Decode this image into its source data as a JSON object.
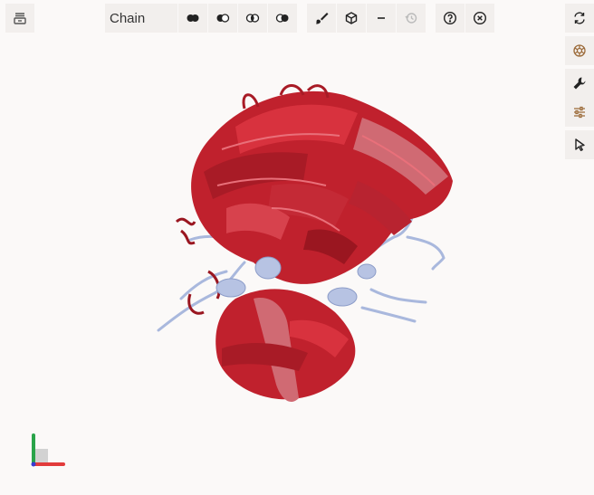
{
  "toolbar": {
    "coloring_select": {
      "value": "Chain"
    }
  },
  "icons": {
    "sequence_toggle": "panel-icon",
    "rep_modes": [
      "cartoon-icon",
      "surface-icon",
      "ball-stick-icon",
      "spacefill-icon"
    ],
    "style": [
      "brush-icon",
      "cube-icon",
      "minus-icon",
      "history-icon"
    ],
    "help": [
      "help-icon",
      "close-icon"
    ],
    "sidebar": [
      "reset-icon",
      "screenshot-icon",
      "wrench-icon",
      "settings-icon",
      "select-icon"
    ]
  },
  "colors": {
    "strand_red": "#c0212d",
    "strand_dark": "#9a1620",
    "strand_pink": "#d06a73",
    "coil_blue": "#a9b8dd",
    "axis_x": "#e23b3b",
    "axis_y": "#2aa44a",
    "axis_z": "#3a3ad0"
  }
}
